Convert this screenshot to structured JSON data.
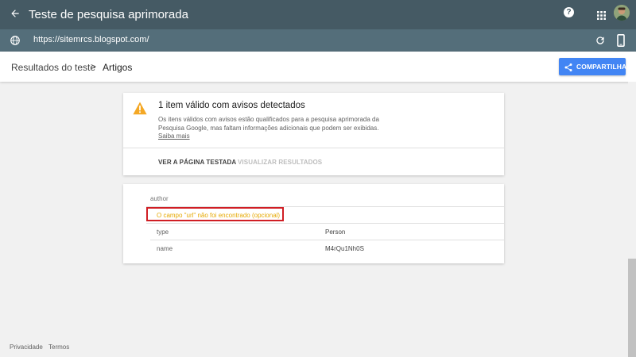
{
  "appbar": {
    "title": "Teste de pesquisa aprimorada",
    "back_icon": "arrow-left-icon",
    "help_icon": "help-icon",
    "apps_icon": "apps-grid-icon",
    "avatar_icon": "user-avatar"
  },
  "urlbar": {
    "url": "https://sitemrcs.blogspot.com/",
    "globe_icon": "globe-icon",
    "reload_icon": "reload-icon",
    "mobile_icon": "mobile-device-icon"
  },
  "header": {
    "breadcrumb_root": "Resultados do teste",
    "breadcrumb_separator": ">",
    "breadcrumb_current": "Artigos",
    "share_label": "COMPARTILHAR",
    "share_color": "#4285f4"
  },
  "summary_card": {
    "title": "1 item válido com avisos detectados",
    "description": "Os itens válidos com avisos estão qualificados para a pesquisa aprimorada da Pesquisa Google, mas faltam informações adicionais que podem ser exibidas.",
    "learn_more": "Saiba mais",
    "view_tested_page": "VER A PÁGINA TESTADA",
    "view_results": "VISUALIZAR RESULTADOS",
    "warning_color": "#f4a825"
  },
  "details_card": {
    "section": "author",
    "warning": "O campo \"url\" não foi encontrado (opcional)",
    "warning_color": "#e6a800",
    "highlight_color": "#d01e24",
    "rows": [
      {
        "key": "type",
        "value": "Person"
      },
      {
        "key": "name",
        "value": "M4rQu1Nh0S"
      }
    ]
  },
  "footer": {
    "privacy": "Privacidade",
    "terms": "Termos"
  }
}
